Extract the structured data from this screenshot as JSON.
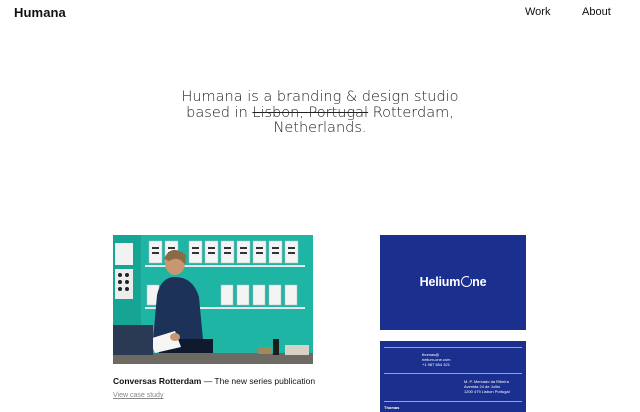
{
  "header": {
    "logo": "Humana",
    "nav": {
      "work": "Work",
      "about": "About"
    }
  },
  "hero": {
    "line1": "Humana is a branding & design studio",
    "line2_prefix": "based in ",
    "struck_text": "Lisbon, Portugal",
    "line2_suffix": " Rotterdam,",
    "line3": "Netherlands."
  },
  "projects": [
    {
      "title": "Conversas Rotterdam",
      "subtitle": " — The new series publication",
      "link": "View case study"
    }
  ],
  "helium_card": {
    "brand_prefix": "Helium",
    "brand_suffix": "ne",
    "contact": [
      "thomas@",
      "helium-one.com",
      "+1 987 654 321"
    ],
    "address": [
      "M. P. Mercado da Ribeira",
      "Avenida 24 de Julho",
      "1200 479 Lisbon Portugal"
    ],
    "name": "Thomas"
  },
  "colors": {
    "accent_blue": "#1b2f8f",
    "photo_teal": "#1fb5a4"
  }
}
